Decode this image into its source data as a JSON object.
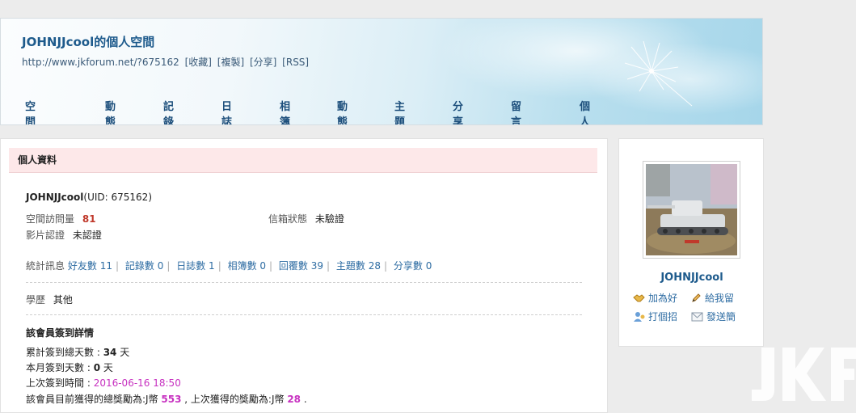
{
  "header": {
    "title": "JOHNJJcool的個人空間",
    "url": "http://www.jkforum.net/?675162",
    "links": [
      "[收藏]",
      "[複製]",
      "[分享]",
      "[RSS]"
    ]
  },
  "nav": [
    "空間首頁",
    "動態",
    "記錄",
    "日誌",
    "相簿",
    "動態",
    "主題",
    "分享",
    "留言板",
    "個人資料"
  ],
  "profile": {
    "panel_title": "個人資料",
    "username": "JOHNJJcool",
    "uid": "(UID: 675162)",
    "visits_label": "空間訪問量",
    "visits_value": "81",
    "mail_status_label": "信箱狀態",
    "mail_status_value": "未驗證",
    "video_label": "影片認證",
    "video_value": "未認證",
    "stats_label": "統計訊息",
    "stats": [
      {
        "label": "好友數",
        "value": "11"
      },
      {
        "label": "記錄數",
        "value": "0"
      },
      {
        "label": "日誌數",
        "value": "1"
      },
      {
        "label": "相簿數",
        "value": "0"
      },
      {
        "label": "回覆數",
        "value": "39"
      },
      {
        "label": "主題數",
        "value": "28"
      },
      {
        "label": "分享數",
        "value": "0"
      }
    ],
    "edu_label": "學歷",
    "edu_value": "其他",
    "signin_title": "該會員簽到詳情",
    "total_days_label": "累計簽到總天數 : ",
    "total_days_value": "34",
    "total_days_unit": " 天",
    "month_days_label": "本月簽到天數 : ",
    "month_days_value": "0",
    "month_days_unit": " 天",
    "last_time_label": "上次簽到時間 : ",
    "last_time_value": "2016-06-16 18:50",
    "reward_prefix": "該會員目前獲得的總獎勵為:J幣 ",
    "reward_total": "553",
    "reward_mid": " , 上次獲得的獎勵為:J幣 ",
    "reward_last": "28",
    "reward_end": " ."
  },
  "sidebar": {
    "name": "JOHNJJcool",
    "actions": [
      "加為好",
      "給我留",
      "打個招",
      "發送簡"
    ]
  },
  "watermark": "JKF"
}
